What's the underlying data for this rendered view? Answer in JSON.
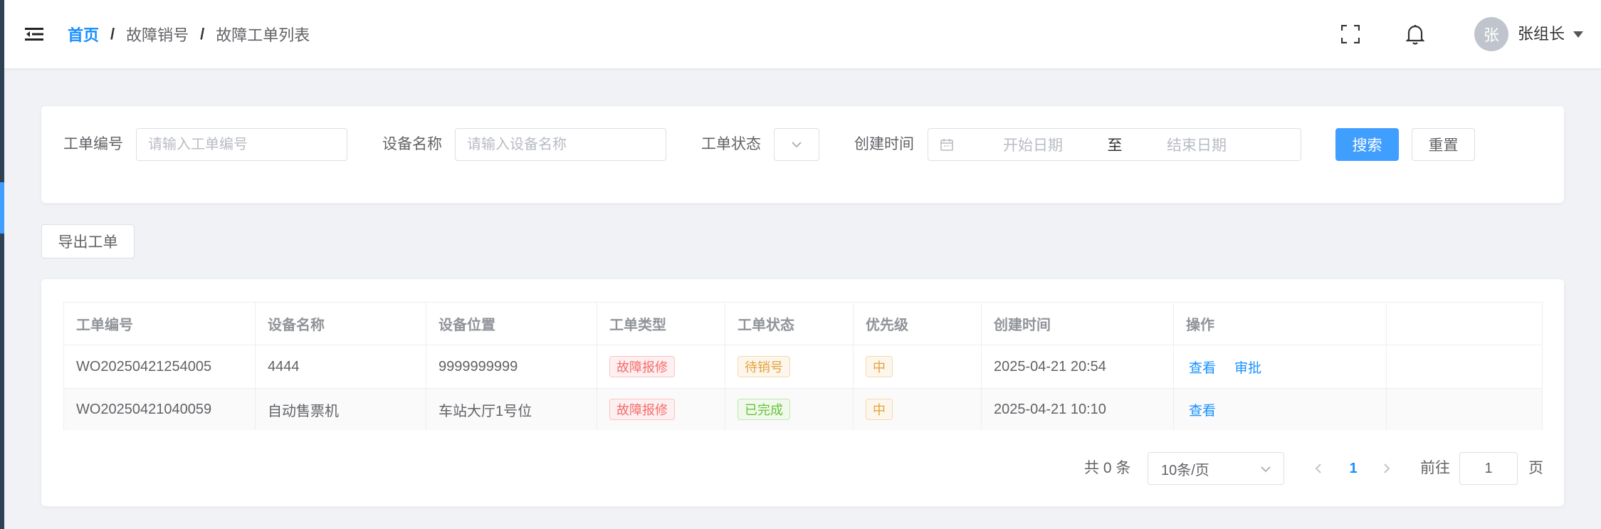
{
  "header": {
    "breadcrumb": [
      "首页",
      "故障销号",
      "故障工单列表"
    ],
    "avatar_text": "张",
    "user_name": "张组长"
  },
  "search_form": {
    "order_no_label": "工单编号",
    "order_no_placeholder": "请输入工单编号",
    "device_name_label": "设备名称",
    "device_name_placeholder": "请输入设备名称",
    "status_label": "工单状态",
    "created_time_label": "创建时间",
    "start_date_placeholder": "开始日期",
    "range_separator": "至",
    "end_date_placeholder": "结束日期",
    "search_button": "搜索",
    "reset_button": "重置"
  },
  "toolbar": {
    "export_button": "导出工单"
  },
  "table": {
    "columns": [
      "工单编号",
      "设备名称",
      "设备位置",
      "工单类型",
      "工单状态",
      "优先级",
      "创建时间",
      "操作"
    ],
    "rows": [
      {
        "order_no": "WO20250421254005",
        "device_name": "4444",
        "location": "9999999999",
        "type": "故障报修",
        "status": "待销号",
        "priority": "中",
        "created": "2025-04-21 20:54",
        "actions": [
          "查看",
          "审批"
        ]
      },
      {
        "order_no": "WO20250421040059",
        "device_name": "自动售票机",
        "location": "车站大厅1号位",
        "type": "故障报修",
        "status": "已完成",
        "priority": "中",
        "created": "2025-04-21 10:10",
        "actions": [
          "查看"
        ]
      }
    ]
  },
  "pagination": {
    "total_text": "共 0 条",
    "page_size": "10条/页",
    "current_page": "1",
    "goto_label": "前往",
    "goto_value": "1",
    "page_suffix": "页"
  },
  "colors": {
    "primary": "#409eff",
    "link": "#1890ff",
    "tag_danger": "#f56c6c",
    "tag_warning": "#e6a23c",
    "tag_success": "#67c23a",
    "sidebar": "#304156"
  },
  "icons": {
    "menu": "hamburger-icon",
    "fullscreen": "fullscreen-icon",
    "notification": "bell-icon",
    "calendar": "calendar-icon"
  }
}
